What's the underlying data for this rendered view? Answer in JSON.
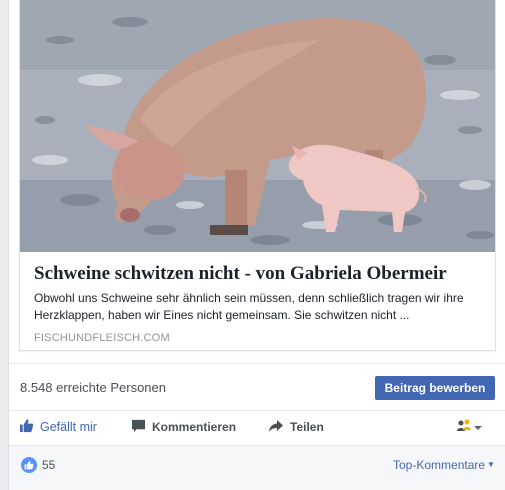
{
  "link_preview": {
    "image_alt": "Sau mit Ferkel",
    "title": "Schweine schwitzen nicht - von Gabriela Obermeir",
    "description_line1": "Obwohl uns Schweine sehr ähnlich sein müssen, denn schließlich tragen wir ihre",
    "description_line2": "Herzklappen, haben wir Eines nicht gemeinsam. Sie schwitzen nicht ...",
    "domain": "FISCHUNDFLEISCH.COM"
  },
  "reach": {
    "text": "8.548 erreichte Personen",
    "promote_label": "Beitrag bewerben"
  },
  "actions": {
    "like_label": "Gefällt mir",
    "comment_label": "Kommentieren",
    "share_label": "Teilen",
    "audience_icon": "audience-selector-icon"
  },
  "reactions": {
    "count": "55",
    "sort_label": "Top-Kommentare"
  },
  "colors": {
    "brand": "#4267b2",
    "like_badge": "#5890ff",
    "muted": "#90949c"
  }
}
